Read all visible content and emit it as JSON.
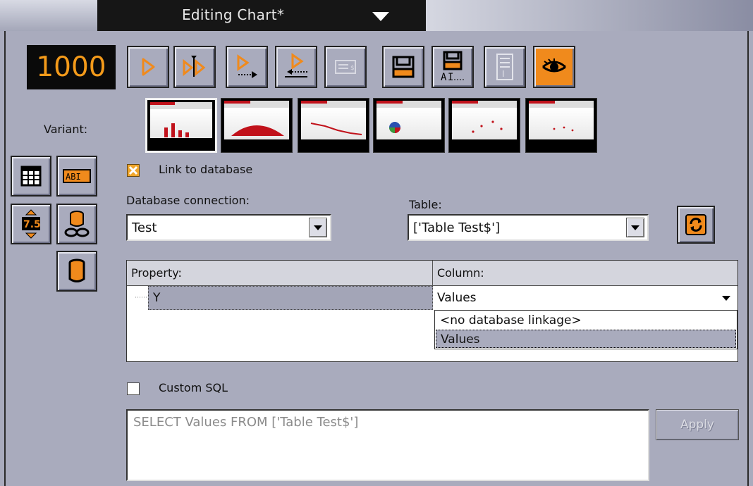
{
  "title_bar": {
    "title": "Editing Chart*",
    "menu_icon": "chevron-down-icon"
  },
  "counter": "1000",
  "toolbar": [
    {
      "name": "play-button",
      "icon": "play-icon",
      "active": false
    },
    {
      "name": "play-step-button",
      "icon": "play-step-icon",
      "active": false
    },
    {
      "name": "play-out-button",
      "icon": "play-out-icon",
      "active": false
    },
    {
      "name": "play-in-button",
      "icon": "play-in-icon",
      "active": false
    },
    {
      "name": "text-edit-button",
      "icon": "text-edit-icon",
      "active": false
    },
    {
      "name": "save-button",
      "icon": "save-icon",
      "active": false
    },
    {
      "name": "save-as-button",
      "icon": "save-as-icon",
      "active": false,
      "text": "AI"
    },
    {
      "name": "properties-button",
      "icon": "document-icon",
      "active": false
    },
    {
      "name": "preview-button",
      "icon": "eye-icon",
      "active": true
    }
  ],
  "variant": {
    "label": "Variant:",
    "thumbnails": [
      {
        "name": "variant-bar",
        "kind": "bar",
        "selected": true
      },
      {
        "name": "variant-area",
        "kind": "area",
        "selected": false
      },
      {
        "name": "variant-line",
        "kind": "line",
        "selected": false
      },
      {
        "name": "variant-pie",
        "kind": "pie",
        "selected": false
      },
      {
        "name": "variant-scatter",
        "kind": "scatter",
        "selected": false
      },
      {
        "name": "variant-points",
        "kind": "points",
        "selected": false
      }
    ]
  },
  "side_tools": [
    "table-icon",
    "text-field-icon",
    "value-stepper-icon",
    "database-link-icon",
    "database-icon"
  ],
  "link_to_database": {
    "label": "Link to database",
    "checked": true
  },
  "db_connection": {
    "label": "Database connection:",
    "value": "Test"
  },
  "table": {
    "label": "Table:",
    "value": "['Table Test$']"
  },
  "refresh_icon": "refresh-icon",
  "grid": {
    "headers": [
      "Property:",
      "Column:"
    ],
    "rows": [
      {
        "property": "Y",
        "column": "Values"
      }
    ],
    "dropdown_options": [
      "<no database linkage>",
      "Values"
    ],
    "dropdown_selected": "Values"
  },
  "custom_sql": {
    "label": "Custom SQL",
    "checked": false,
    "query": "SELECT Values FROM ['Table Test$']"
  },
  "apply_label": "Apply",
  "colors": {
    "accent": "#f08a1c",
    "panel": "#a9abbd",
    "counter_text": "#f39a1a"
  }
}
